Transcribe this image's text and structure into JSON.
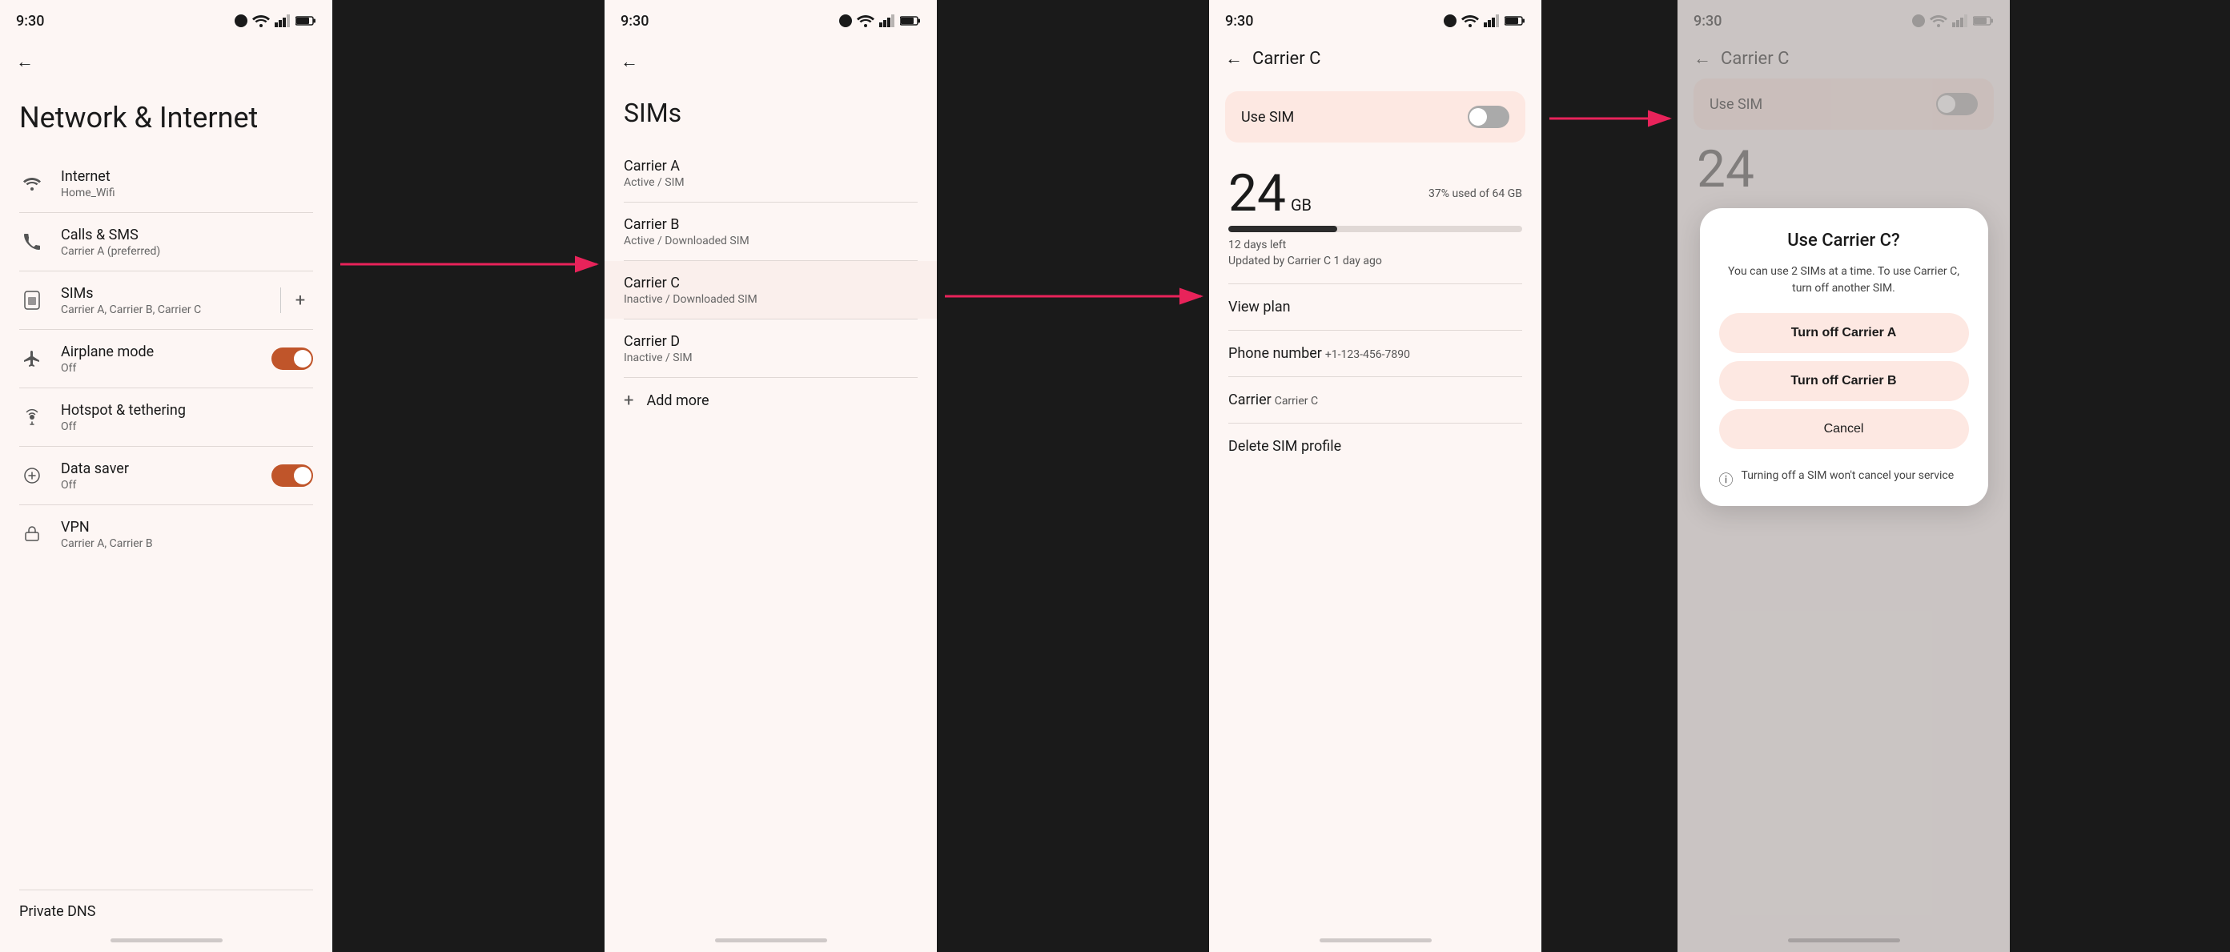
{
  "screens": [
    {
      "id": "screen1",
      "statusBar": {
        "time": "9:30",
        "icons": [
          "wifi",
          "signal",
          "battery"
        ]
      },
      "title": "Network & Internet",
      "items": [
        {
          "icon": "wifi",
          "label": "Internet",
          "sublabel": "Home_Wifi"
        },
        {
          "icon": "phone",
          "label": "Calls & SMS",
          "sublabel": "Carrier A (preferred)"
        },
        {
          "icon": "sim",
          "label": "SIMs",
          "sublabel": "Carrier A, Carrier B, Carrier C",
          "hasAddBtn": true
        },
        {
          "icon": "airplane",
          "label": "Airplane mode",
          "sublabel": "Off",
          "toggle": "on"
        },
        {
          "icon": "hotspot",
          "label": "Hotspot & tethering",
          "sublabel": "Off"
        },
        {
          "icon": "datasaver",
          "label": "Data saver",
          "sublabel": "Off",
          "toggle": "on"
        },
        {
          "icon": "vpn",
          "label": "VPN",
          "sublabel": "Carrier A, Carrier B"
        }
      ],
      "footer": "Private DNS"
    },
    {
      "id": "screen2",
      "statusBar": {
        "time": "9:30"
      },
      "backLabel": "",
      "title": "SIMs",
      "sims": [
        {
          "name": "Carrier A",
          "status": "Active / SIM"
        },
        {
          "name": "Carrier B",
          "status": "Active / Downloaded SIM"
        },
        {
          "name": "Carrier C",
          "status": "Inactive / Downloaded SIM"
        },
        {
          "name": "Carrier D",
          "status": "Inactive / SIM"
        }
      ],
      "addMore": "Add more"
    },
    {
      "id": "screen3",
      "statusBar": {
        "time": "9:30"
      },
      "backLabel": "Carrier C",
      "useSim": "Use SIM",
      "dataAmount": "24",
      "dataUnit": "GB",
      "dataPercent": "37% used of 64 GB",
      "daysLeft": "12 days left",
      "updatedBy": "Updated by Carrier C 1 day ago",
      "details": [
        {
          "label": "View plan",
          "value": ""
        },
        {
          "label": "Phone number",
          "value": "+1-123-456-7890"
        },
        {
          "label": "Carrier",
          "value": "Carrier C"
        },
        {
          "label": "Delete SIM profile",
          "value": ""
        }
      ]
    },
    {
      "id": "screen4",
      "statusBar": {
        "time": "9:30"
      },
      "backLabel": "Carrier C",
      "useSim": "Use SIM",
      "dataNumber": "24",
      "dialog": {
        "title": "Use Carrier C?",
        "description": "You can use 2 SIMs at a time. To use Carrier C, turn off another SIM.",
        "btn1": "Turn off Carrier A",
        "btn2": "Turn off Carrier B",
        "cancel": "Cancel",
        "note": "Turning off a SIM won't cancel your service"
      }
    }
  ],
  "arrows": [
    {
      "id": "arrow1",
      "label": "→ Carrier C row → screen3"
    },
    {
      "id": "arrow2",
      "label": "→ Use SIM toggle → dialog"
    }
  ],
  "icons": {
    "wifi": "📶",
    "back": "←",
    "plus": "+",
    "info": "ⓘ"
  }
}
